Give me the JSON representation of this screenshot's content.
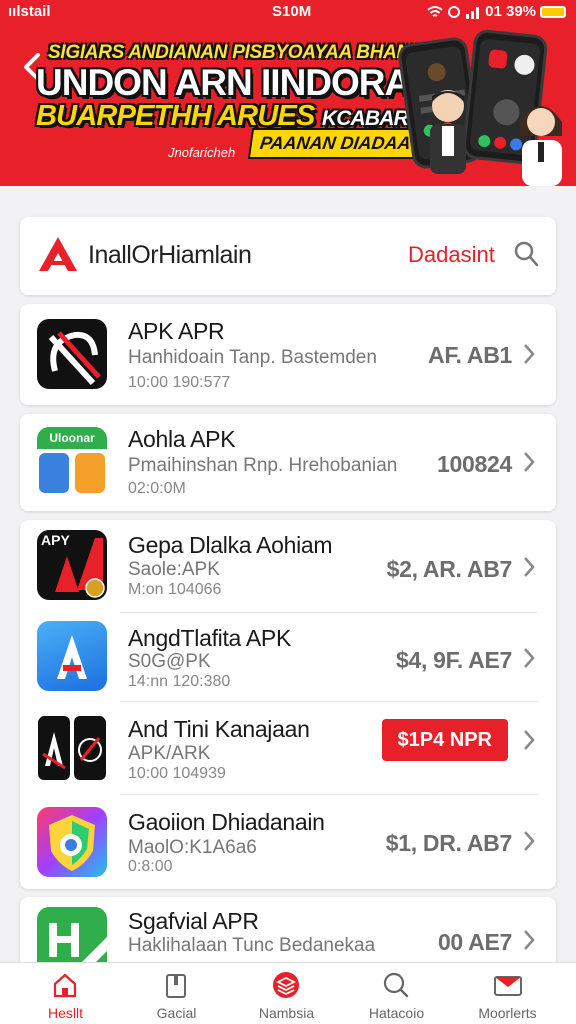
{
  "status_bar": {
    "carrier": "ıılstail",
    "time": "S10M",
    "right_text": "01 39%"
  },
  "hero": {
    "line1": "SIGIARS ANDIANAN PISBYOAYAA BHANI",
    "line2": "UNDON ARN IINDORAN",
    "line3": "BUARPETHH ARUES",
    "line3_small": "KCABAR",
    "caption": "Jnofaricheh",
    "badge": "PAANAN DIADAAT!"
  },
  "search": {
    "title": "InallOrHiamlain",
    "link": "Dadasint"
  },
  "apps": [
    {
      "name": "APK APR",
      "subtitle": "Hanhidoain Tanp. Bastemden",
      "meta": "10:00 190:577",
      "price": "AF. AB1"
    },
    {
      "name": "Aohla APK",
      "subtitle": "Pmaihinshan Rnp. Hrehobanian",
      "meta": "02:0:0M",
      "price": "100824",
      "icon_label": "Uloonar"
    },
    {
      "name": "Gepa Dlalka Aohiam",
      "subtitle": "Saole:APK",
      "meta": "M:on 104066",
      "price": "$2, AR. AB7",
      "icon_label": "APY"
    },
    {
      "name": "AngdTlafita APK",
      "subtitle": "S0G@PK",
      "meta": "14:nn 120:380",
      "price": "$4, 9F. AE7"
    },
    {
      "name": "And Tini Kanajaan",
      "subtitle": "APK/ARK",
      "meta": "10:00 104939",
      "price": "$1P4 NPR"
    },
    {
      "name": "Gaoiion Dhiadanain",
      "subtitle": "MaolO:K1A6a6",
      "meta": "0:8:00",
      "price": "$1, DR. AB7"
    },
    {
      "name": "Sgafvial APR",
      "subtitle": "Haklihalaan Tunc Bedanekaa",
      "meta": "",
      "price": "00 AE7"
    }
  ],
  "nav": [
    {
      "label": "Hesllt",
      "active": true
    },
    {
      "label": "Gacial",
      "active": false
    },
    {
      "label": "Nambsia",
      "active": false
    },
    {
      "label": "Hatacoio",
      "active": false
    },
    {
      "label": "Moorlerts",
      "active": false
    }
  ],
  "colors": {
    "brand_red": "#e8202a",
    "background": "#f2f2f4",
    "badge_yellow": "#ffd600"
  }
}
